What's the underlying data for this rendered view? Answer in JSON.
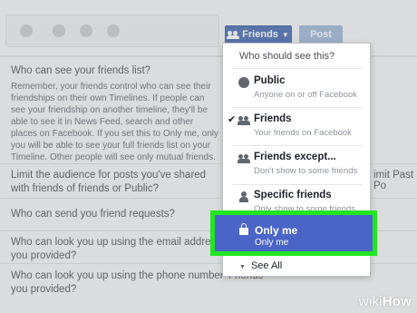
{
  "toolbar": {
    "friends_button_label": "Friends",
    "post_button_label": "Post"
  },
  "settings": {
    "friends_list_question": "Who can see your friends list?",
    "friends_list_description": "Remember, your friends control who can see their friendships on their own Timelines. If people can see your friendship on another timeline, they'll be able to see it in News Feed, search and other places on Facebook. If you set this to Only me, only you will be able to see your full friends list on your Timeline. Other people will see only mutual friends.",
    "limit_question": "Limit the audience for posts you've shared with friends of friends or Public?",
    "limit_link": "imit Past Po",
    "friend_requests_question": "Who can send you friend requests?",
    "email_question": "Who can look you up using the email address you provided?",
    "phone_question": "Who can look you up using the phone number you provided?",
    "phone_value": "Friends"
  },
  "dropdown": {
    "header": "Who should see this?",
    "items": [
      {
        "title": "Public",
        "subtitle": "Anyone on or off Facebook",
        "icon": "globe-icon",
        "checked": false
      },
      {
        "title": "Friends",
        "subtitle": "Your friends on Facebook",
        "icon": "friends-icon",
        "checked": true
      },
      {
        "title": "Friends except...",
        "subtitle": "Don't show to some friends",
        "icon": "friends-except-icon",
        "checked": false
      },
      {
        "title": "Specific friends",
        "subtitle": "Only show to some friends",
        "icon": "person-icon",
        "checked": false
      },
      {
        "title": "Only me",
        "subtitle": "Only me",
        "icon": "lock-icon",
        "checked": false,
        "highlighted": true
      }
    ],
    "see_all": "See All"
  },
  "watermark": {
    "wiki": "wiki",
    "how": "How"
  },
  "colors": {
    "facebook_blue": "#4267b2",
    "highlight_blue": "#4a64c8",
    "highlight_border": "#22e622"
  }
}
